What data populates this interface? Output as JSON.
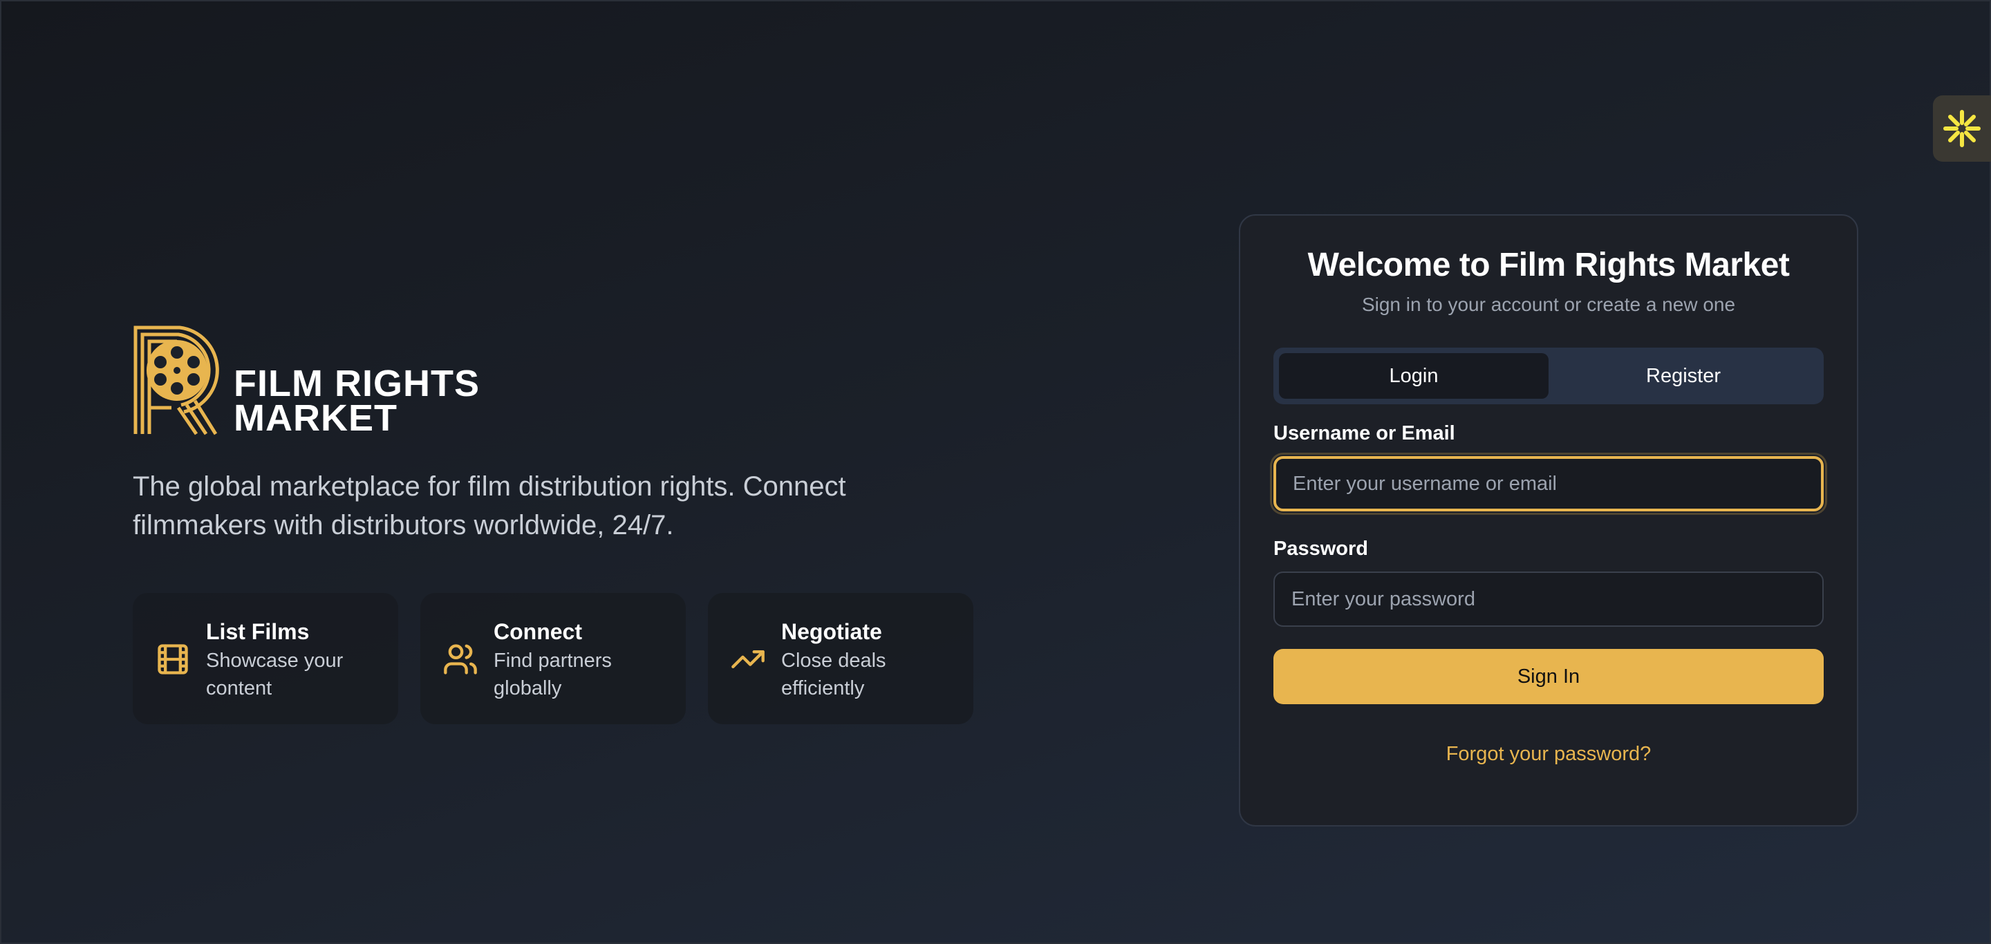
{
  "brand": {
    "name_line1": "FILM RIGHTS",
    "name_line2": "MARKET",
    "tagline": "The global marketplace for film distribution rights. Connect filmmakers with distributors worldwide, 24/7.",
    "accent_color": "#e8b54f"
  },
  "features": [
    {
      "icon": "film-icon",
      "title": "List Films",
      "description": "Showcase your content"
    },
    {
      "icon": "users-icon",
      "title": "Connect",
      "description": "Find partners globally"
    },
    {
      "icon": "trending-up-icon",
      "title": "Negotiate",
      "description": "Close deals efficiently"
    }
  ],
  "login_card": {
    "title": "Welcome to Film Rights Market",
    "subtitle": "Sign in to your account or create a new one",
    "tabs": [
      {
        "label": "Login",
        "active": true
      },
      {
        "label": "Register",
        "active": false
      }
    ],
    "username": {
      "label": "Username or Email",
      "placeholder": "Enter your username or email",
      "value": ""
    },
    "password": {
      "label": "Password",
      "placeholder": "Enter your password",
      "value": ""
    },
    "submit_label": "Sign In",
    "forgot_label": "Forgot your password?"
  },
  "edge_widget": {
    "icon": "sparkle-icon",
    "color": "#f5e642"
  }
}
